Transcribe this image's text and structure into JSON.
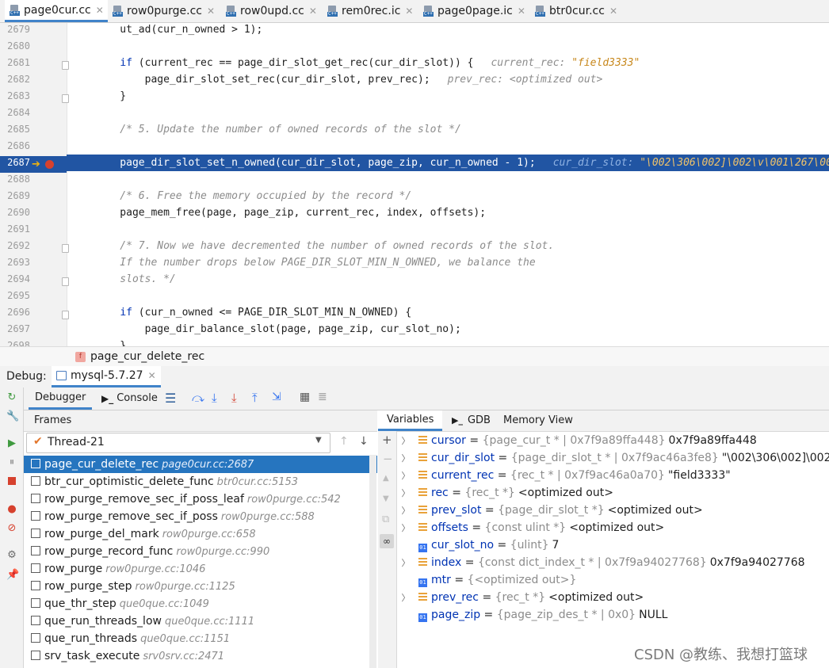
{
  "editor_tabs": [
    {
      "label": "page0cur.cc",
      "active": true
    },
    {
      "label": "row0purge.cc",
      "active": false
    },
    {
      "label": "row0upd.cc",
      "active": false
    },
    {
      "label": "rem0rec.ic",
      "active": false
    },
    {
      "label": "page0page.ic",
      "active": false
    },
    {
      "label": "btr0cur.cc",
      "active": false
    }
  ],
  "code": {
    "lines": [
      {
        "num": "2679",
        "text": "    ut_ad(cur_n_owned > 1);"
      },
      {
        "num": "2680",
        "text": ""
      },
      {
        "num": "2681",
        "kw": "if",
        "text": " (current_rec == page_dir_slot_get_rec(cur_dir_slot)) {",
        "hint_name": "current_rec:",
        "hint_value": "\"field3333\""
      },
      {
        "num": "2682",
        "text": "        page_dir_slot_set_rec(cur_dir_slot, prev_rec);",
        "hint_name": "prev_rec:",
        "hint_value_plain": "<optimized out>"
      },
      {
        "num": "2683",
        "text": "    }"
      },
      {
        "num": "2684",
        "text": ""
      },
      {
        "num": "2685",
        "comment": "    /* 5. Update the number of owned records of the slot */"
      },
      {
        "num": "2686",
        "text": ""
      },
      {
        "num": "2687",
        "text": "    page_dir_slot_set_n_owned(cur_dir_slot, page_zip, cur_n_owned - 1);",
        "hint_name": "cur_dir_slot:",
        "hint_value": "\"\\002\\306\\002]\\002\\v\\001\\267\\001\\266",
        "highlight": true
      },
      {
        "num": "2688",
        "text": ""
      },
      {
        "num": "2689",
        "comment": "    /* 6. Free the memory occupied by the record */"
      },
      {
        "num": "2690",
        "text": "    page_mem_free(page, page_zip, current_rec, index, offsets);"
      },
      {
        "num": "2691",
        "text": ""
      },
      {
        "num": "2692",
        "comment": "    /* 7. Now we have decremented the number of owned records of the slot."
      },
      {
        "num": "2693",
        "comment": "    If the number drops below PAGE_DIR_SLOT_MIN_N_OWNED, we balance the"
      },
      {
        "num": "2694",
        "comment": "    slots. */"
      },
      {
        "num": "2695",
        "text": ""
      },
      {
        "num": "2696",
        "kw": "if",
        "text": " (cur_n_owned <= PAGE_DIR_SLOT_MIN_N_OWNED) {"
      },
      {
        "num": "2697",
        "text": "        page_dir_balance_slot(page, page_zip, cur_slot_no);"
      },
      {
        "num": "2698",
        "text": "    }"
      }
    ]
  },
  "breadcrumb": {
    "icon": "f",
    "label": "page_cur_delete_rec"
  },
  "debug": {
    "label": "Debug:",
    "session": "mysql-5.7.27",
    "tabs": {
      "debugger": "Debugger",
      "console": "Console"
    },
    "frames_title": "Frames",
    "thread": "Thread-21",
    "frames": [
      {
        "fn": "page_cur_delete_rec",
        "loc": "page0cur.cc:2687",
        "selected": true
      },
      {
        "fn": "btr_cur_optimistic_delete_func",
        "loc": "btr0cur.cc:5153"
      },
      {
        "fn": "row_purge_remove_sec_if_poss_leaf",
        "loc": "row0purge.cc:542"
      },
      {
        "fn": "row_purge_remove_sec_if_poss",
        "loc": "row0purge.cc:588"
      },
      {
        "fn": "row_purge_del_mark",
        "loc": "row0purge.cc:658"
      },
      {
        "fn": "row_purge_record_func",
        "loc": "row0purge.cc:990"
      },
      {
        "fn": "row_purge",
        "loc": "row0purge.cc:1046"
      },
      {
        "fn": "row_purge_step",
        "loc": "row0purge.cc:1125"
      },
      {
        "fn": "que_thr_step",
        "loc": "que0que.cc:1049"
      },
      {
        "fn": "que_run_threads_low",
        "loc": "que0que.cc:1111"
      },
      {
        "fn": "que_run_threads",
        "loc": "que0que.cc:1151"
      },
      {
        "fn": "srv_task_execute",
        "loc": "srv0srv.cc:2471"
      }
    ],
    "var_tabs": {
      "variables": "Variables",
      "gdb": "GDB",
      "memory": "Memory View"
    },
    "variables": [
      {
        "name": "cursor",
        "type": "{page_cur_t * | 0x7f9a89ffa448}",
        "value": "0x7f9a89ffa448",
        "expandable": true,
        "kind": "field"
      },
      {
        "name": "cur_dir_slot",
        "type": "{page_dir_slot_t * | 0x7f9ac46a3fe8}",
        "value": "\"\\002\\306\\002]\\002\\v\\00",
        "expandable": true,
        "kind": "field"
      },
      {
        "name": "current_rec",
        "type": "{rec_t * | 0x7f9ac46a0a70}",
        "value": "\"field3333\"",
        "expandable": true,
        "kind": "field"
      },
      {
        "name": "rec",
        "type": "{rec_t *}",
        "value": "<optimized out>",
        "expandable": true,
        "kind": "field"
      },
      {
        "name": "prev_slot",
        "type": "{page_dir_slot_t *}",
        "value": "<optimized out>",
        "expandable": true,
        "kind": "field"
      },
      {
        "name": "offsets",
        "type": "{const ulint *}",
        "value": "<optimized out>",
        "expandable": true,
        "kind": "field"
      },
      {
        "name": "cur_slot_no",
        "type": "{ulint}",
        "value": "7",
        "expandable": false,
        "kind": "prim"
      },
      {
        "name": "index",
        "type": "{const dict_index_t * | 0x7f9a94027768}",
        "value": "0x7f9a94027768",
        "expandable": true,
        "kind": "field"
      },
      {
        "name": "mtr",
        "type": "{<optimized out>}",
        "value": "",
        "expandable": false,
        "kind": "prim"
      },
      {
        "name": "prev_rec",
        "type": "{rec_t *}",
        "value": "<optimized out>",
        "expandable": true,
        "kind": "field"
      },
      {
        "name": "page_zip",
        "type": "{page_zip_des_t * | 0x0}",
        "value": "NULL",
        "expandable": false,
        "kind": "prim"
      }
    ]
  },
  "watermark": "CSDN @教练、我想打篮球"
}
